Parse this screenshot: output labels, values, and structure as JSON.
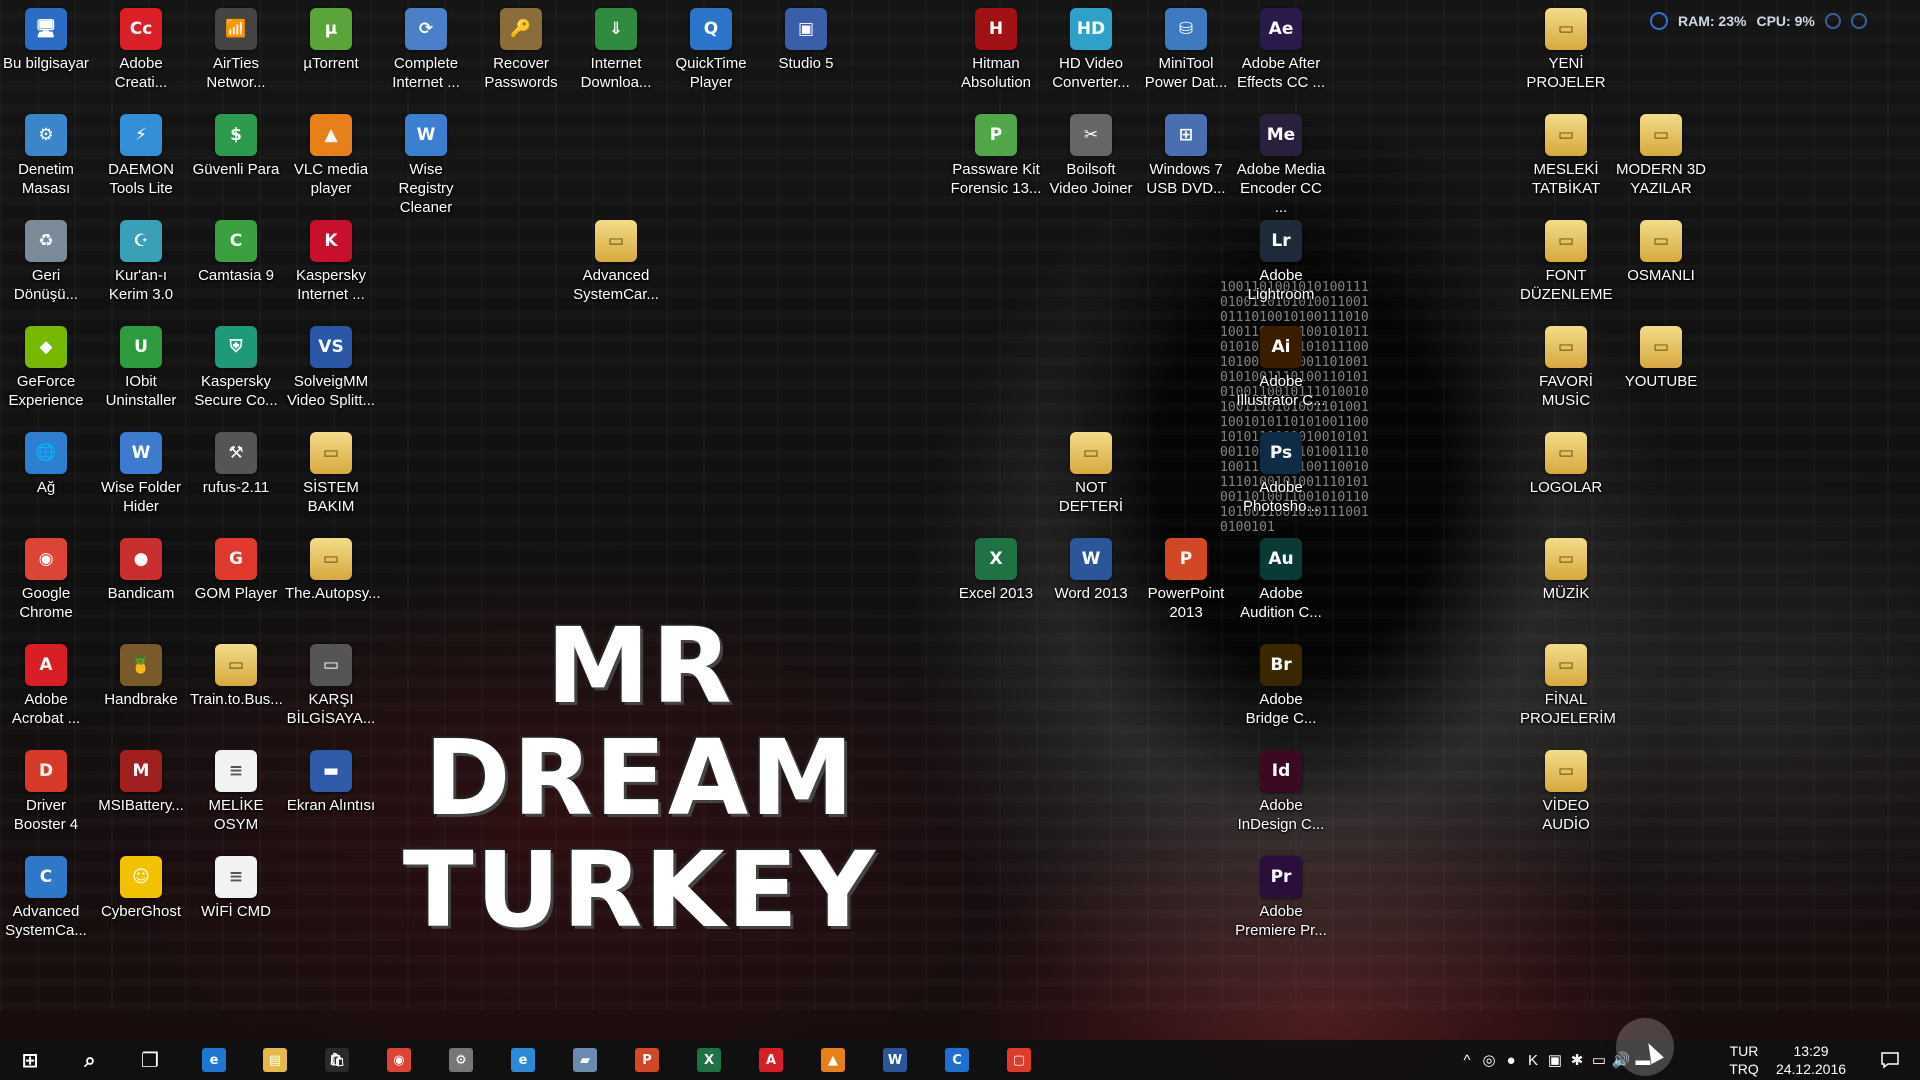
{
  "desktop": {
    "icons": [
      {
        "label": "Bu bilgisayar",
        "glyph": "🖥",
        "color": "#2b6cc4"
      },
      {
        "label": "Adobe\nCreati...",
        "glyph": "Cc",
        "color": "#da1f26"
      },
      {
        "label": "AirTies\nNetwor...",
        "glyph": "📶",
        "color": "#444"
      },
      {
        "label": "µTorrent",
        "glyph": "µ",
        "color": "#5aa43a"
      },
      {
        "label": "Complete\nInternet ...",
        "glyph": "⟳",
        "color": "#4b7fc8"
      },
      {
        "label": "Recover\nPasswords",
        "glyph": "🔑",
        "color": "#8a6d3b"
      },
      {
        "label": "Internet\nDownloa...",
        "glyph": "⇓",
        "color": "#2f8a3f"
      },
      {
        "label": "QuickTime\nPlayer",
        "glyph": "Q",
        "color": "#2a74c9"
      },
      {
        "label": "Studio 5",
        "glyph": "▣",
        "color": "#3b5ea8"
      },
      {
        "label": "Hitman\nAbsolution",
        "glyph": "H",
        "color": "#a01014"
      },
      {
        "label": "HD Video\nConverter...",
        "glyph": "HD",
        "color": "#2fa0c8"
      },
      {
        "label": "MiniTool\nPower Dat...",
        "glyph": "⛁",
        "color": "#3e7ac0"
      },
      {
        "label": "Adobe After\nEffects CC ...",
        "glyph": "Ae",
        "color": "#2a1a4a"
      },
      {
        "label": "YENİ\nPROJELER",
        "glyph": "",
        "color": "folder"
      },
      {
        "label": "Denetim\nMasası",
        "glyph": "⚙",
        "color": "#3a86c8"
      },
      {
        "label": "DAEMON\nTools Lite",
        "glyph": "⚡",
        "color": "#3390d8"
      },
      {
        "label": "Güvenli Para",
        "glyph": "$",
        "color": "#2e9a4d"
      },
      {
        "label": "VLC media\nplayer",
        "glyph": "▲",
        "color": "#e8801a"
      },
      {
        "label": "Wise Registry\nCleaner",
        "glyph": "W",
        "color": "#3a7fd0"
      },
      {
        "label": "Passware Kit\nForensic 13...",
        "glyph": "P",
        "color": "#52a64a"
      },
      {
        "label": "Boilsoft\nVideo Joiner",
        "glyph": "✂",
        "color": "#666"
      },
      {
        "label": "Windows 7\nUSB DVD...",
        "glyph": "⊞",
        "color": "#4a6fb0"
      },
      {
        "label": "Adobe Media\nEncoder CC ...",
        "glyph": "Me",
        "color": "#2a1f3c"
      },
      {
        "label": "MESLEKİ\nTATBİKAT",
        "glyph": "",
        "color": "folder"
      },
      {
        "label": "MODERN 3D\nYAZILAR",
        "glyph": "",
        "color": "folder"
      },
      {
        "label": "Geri\nDönüşü...",
        "glyph": "♻",
        "color": "#7a8a99"
      },
      {
        "label": "Kur'an-ı\nKerim 3.0",
        "glyph": "☪",
        "color": "#3aa0b8"
      },
      {
        "label": "Camtasia 9",
        "glyph": "C",
        "color": "#3aa040"
      },
      {
        "label": "Kaspersky\nInternet ...",
        "glyph": "K",
        "color": "#c8102e"
      },
      {
        "label": "Advanced\nSystemCar...",
        "glyph": "",
        "color": "folder"
      },
      {
        "label": "Adobe\nLightroom",
        "glyph": "Lr",
        "color": "#1c2a3a"
      },
      {
        "label": "FONT\nDÜZENLEME",
        "glyph": "",
        "color": "folder"
      },
      {
        "label": "OSMANLI",
        "glyph": "",
        "color": "folder"
      },
      {
        "label": "GeForce\nExperience",
        "glyph": "◆",
        "color": "#76b900"
      },
      {
        "label": "IObit\nUninstaller",
        "glyph": "U",
        "color": "#2f9a3e"
      },
      {
        "label": "Kaspersky\nSecure Co...",
        "glyph": "⛨",
        "color": "#1e9a7a"
      },
      {
        "label": "SolveigMM\nVideo Splitt...",
        "glyph": "VS",
        "color": "#2a56a8"
      },
      {
        "label": "Adobe\nIllustrator C...",
        "glyph": "Ai",
        "color": "#3a1d00"
      },
      {
        "label": "FAVORİ\nMUSİC",
        "glyph": "",
        "color": "folder"
      },
      {
        "label": "YOUTUBE",
        "glyph": "",
        "color": "folder"
      },
      {
        "label": "Ağ",
        "glyph": "🌐",
        "color": "#2f7fd0"
      },
      {
        "label": "Wise Folder\nHider",
        "glyph": "W",
        "color": "#3c7bd0"
      },
      {
        "label": "rufus-2.11",
        "glyph": "⚒",
        "color": "#555"
      },
      {
        "label": "SİSTEM\nBAKIM",
        "glyph": "",
        "color": "folder"
      },
      {
        "label": "NOT DEFTERİ",
        "glyph": "",
        "color": "folder"
      },
      {
        "label": "Adobe\nPhotosho...",
        "glyph": "Ps",
        "color": "#0f2b45"
      },
      {
        "label": "LOGOLAR",
        "glyph": "",
        "color": "folder"
      },
      {
        "label": "Google\nChrome",
        "glyph": "◉",
        "color": "#db4437"
      },
      {
        "label": "Bandicam",
        "glyph": "●",
        "color": "#c92f2f"
      },
      {
        "label": "GOM Player",
        "glyph": "G",
        "color": "#e03a2e"
      },
      {
        "label": "The.Autopsy...",
        "glyph": "",
        "color": "folder"
      },
      {
        "label": "Excel 2013",
        "glyph": "X",
        "color": "#1f7244"
      },
      {
        "label": "Word 2013",
        "glyph": "W",
        "color": "#2b579a"
      },
      {
        "label": "PowerPoint\n2013",
        "glyph": "P",
        "color": "#d24726"
      },
      {
        "label": "Adobe\nAudition C...",
        "glyph": "Au",
        "color": "#0a3a36"
      },
      {
        "label": "MÜZİK",
        "glyph": "",
        "color": "folder"
      },
      {
        "label": "Adobe\nAcrobat ...",
        "glyph": "A",
        "color": "#d91f26"
      },
      {
        "label": "Handbrake",
        "glyph": "🍍",
        "color": "#7a5a2a"
      },
      {
        "label": "Train.to.Bus...",
        "glyph": "",
        "color": "folder"
      },
      {
        "label": "KARŞI\nBİLGİSAYA...",
        "glyph": "▭",
        "color": "#555"
      },
      {
        "label": "Adobe\nBridge C...",
        "glyph": "Br",
        "color": "#3a2600"
      },
      {
        "label": "FİNAL\nPROJELERİM",
        "glyph": "",
        "color": "folder"
      },
      {
        "label": "Driver\nBooster 4",
        "glyph": "D",
        "color": "#d83a2a"
      },
      {
        "label": "MSIBattery...",
        "glyph": "M",
        "color": "#a02020"
      },
      {
        "label": "MELİKE\nOSYM",
        "glyph": "",
        "color": "doc"
      },
      {
        "label": "Ekran Alıntısı",
        "glyph": "▬",
        "color": "#2f5aa8"
      },
      {
        "label": "Adobe\nInDesign C...",
        "glyph": "Id",
        "color": "#3b0a22"
      },
      {
        "label": "VİDEO\nAUDİO",
        "glyph": "",
        "color": "folder"
      },
      {
        "label": "Advanced\nSystemCa...",
        "glyph": "C",
        "color": "#2f78c8"
      },
      {
        "label": "CyberGhost",
        "glyph": "☺",
        "color": "#f2c200"
      },
      {
        "label": "WİFİ CMD",
        "glyph": "",
        "color": "doc"
      },
      {
        "label": "Adobe\nPremiere Pr...",
        "glyph": "Pr",
        "color": "#2a0f3a"
      }
    ]
  },
  "watermark": {
    "line1": "MR DREAM",
    "line2": "TURKEY"
  },
  "binary_text": "10011010010101001110100110101010011001011101001010011101010011010011001010110101001100101011100101001010100110100101010011101001101010100110010111010010100111010100110100110010101101010011001010111001010010101001101001010100111010011010101001100101110100101001110101001101001100101011010100110010101110010100101",
  "sysmon": {
    "ram": "RAM: 23%",
    "cpu": "CPU: 9%"
  },
  "taskbar": {
    "apps": [
      {
        "name": "start-button",
        "glyph": "⊞",
        "color": "transparent"
      },
      {
        "name": "search-icon",
        "glyph": "⌕",
        "color": "transparent"
      },
      {
        "name": "task-view-icon",
        "glyph": "❐",
        "color": "transparent"
      },
      {
        "name": "edge-icon",
        "glyph": "e",
        "color": "#1e78d2"
      },
      {
        "name": "file-explorer-icon",
        "glyph": "▤",
        "color": "#e8b84a"
      },
      {
        "name": "store-icon",
        "glyph": "🛍",
        "color": "#2a2a2a"
      },
      {
        "name": "chrome-icon",
        "glyph": "◉",
        "color": "#db4437"
      },
      {
        "name": "recover-passwords-icon",
        "glyph": "⚙",
        "color": "#777"
      },
      {
        "name": "internet-explorer-icon",
        "glyph": "e",
        "color": "#2a8ad8"
      },
      {
        "name": "studio-icon",
        "glyph": "▰",
        "color": "#6a8ab0"
      },
      {
        "name": "powerpoint-icon",
        "glyph": "P",
        "color": "#d24726"
      },
      {
        "name": "excel-icon",
        "glyph": "X",
        "color": "#1f7244"
      },
      {
        "name": "acrobat-icon",
        "glyph": "A",
        "color": "#d91f26"
      },
      {
        "name": "vlc-icon",
        "glyph": "▲",
        "color": "#e8801a"
      },
      {
        "name": "word-icon",
        "glyph": "W",
        "color": "#2b579a"
      },
      {
        "name": "ccleaner-icon",
        "glyph": "C",
        "color": "#1e6fd0"
      },
      {
        "name": "camtasia-recorder-icon",
        "glyph": "▢",
        "color": "#e23a2a"
      }
    ],
    "tray": [
      {
        "name": "show-hidden-icons-icon",
        "glyph": "^"
      },
      {
        "name": "ccleaner-tray-icon",
        "glyph": "◎"
      },
      {
        "name": "bandicam-tray-icon",
        "glyph": "●"
      },
      {
        "name": "kaspersky-tray-icon",
        "glyph": "K"
      },
      {
        "name": "nvidia-tray-icon",
        "glyph": "▣"
      },
      {
        "name": "bluetooth-tray-icon",
        "glyph": "✱"
      },
      {
        "name": "network-tray-icon",
        "glyph": "▭"
      },
      {
        "name": "volume-icon",
        "glyph": "🔊"
      },
      {
        "name": "battery-icon",
        "glyph": "▬"
      }
    ],
    "language": {
      "code": "TUR",
      "layout": "TRQ"
    },
    "clock": {
      "time": "13:29",
      "date": "24.12.2016"
    }
  }
}
